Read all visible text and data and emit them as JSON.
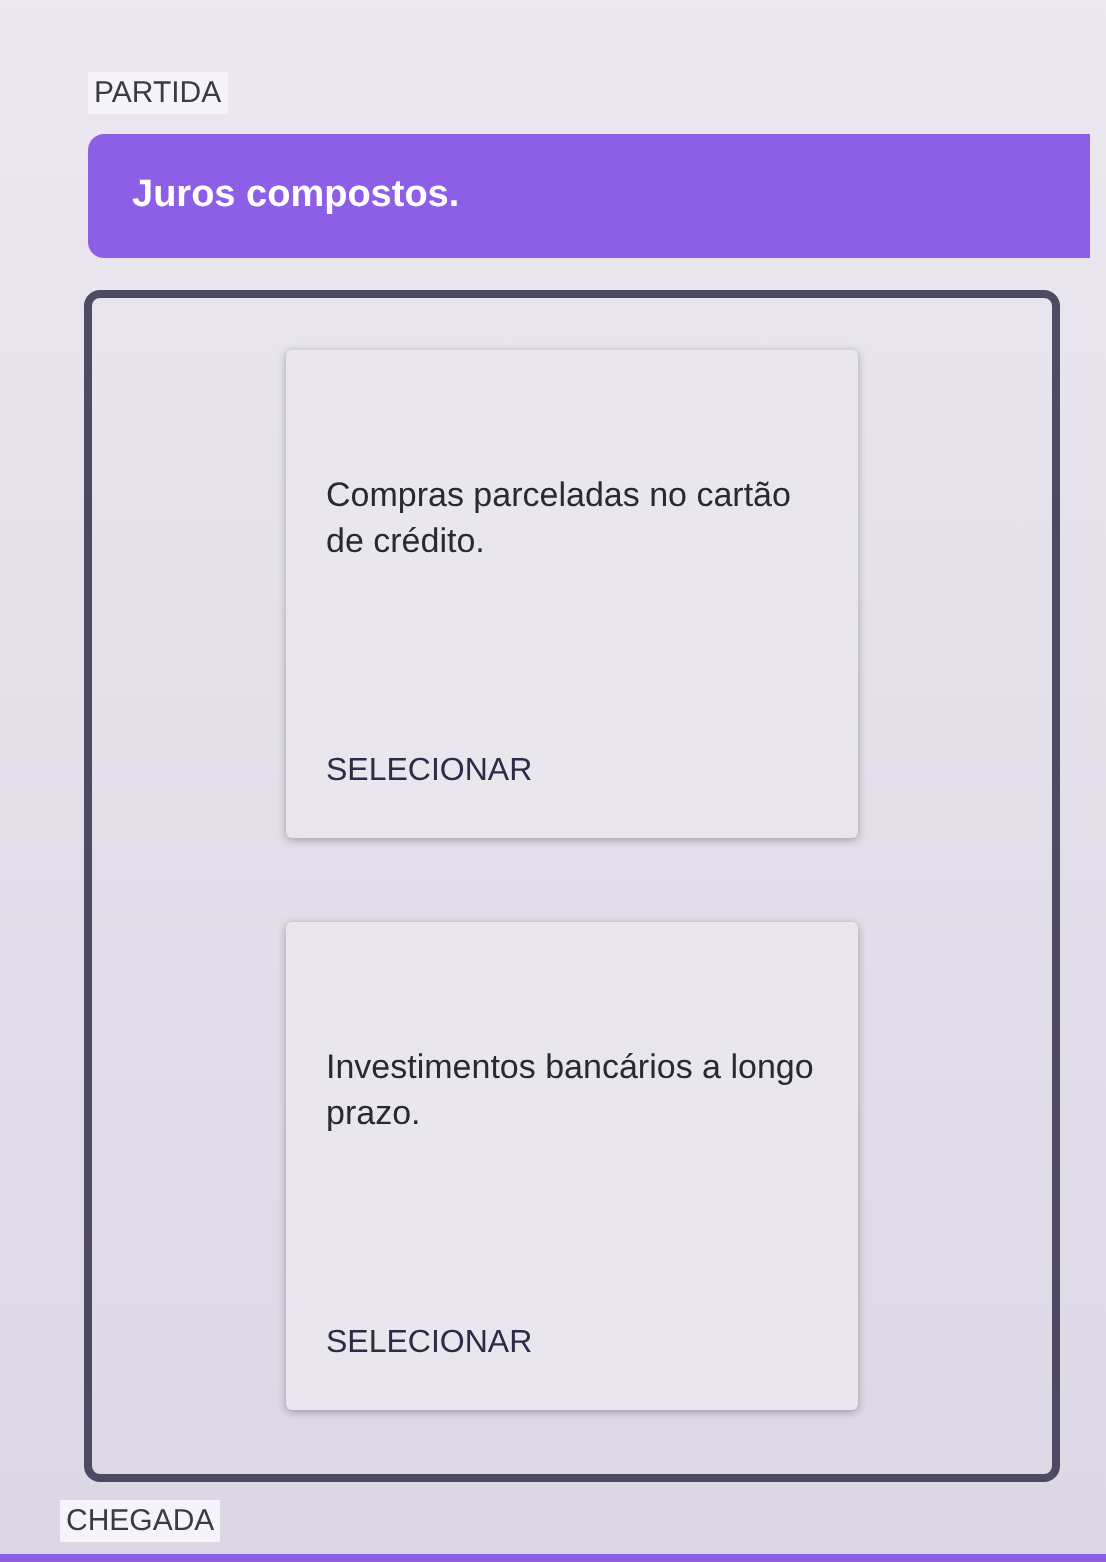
{
  "start_label": "PARTIDA",
  "question": "Juros compostos.",
  "options": [
    {
      "text": "Compras parceladas no cartão de crédito.",
      "button": "SELECIONAR"
    },
    {
      "text": "Investimentos bancários a longo prazo.",
      "button": "SELECIONAR"
    }
  ],
  "end_label": "CHEGADA"
}
